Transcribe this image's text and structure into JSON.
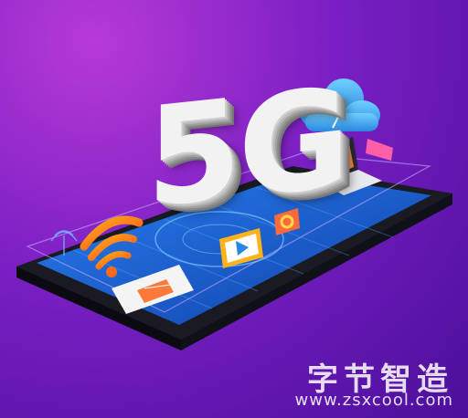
{
  "hero": {
    "text": "5G"
  },
  "watermark": {
    "title": "字节智造",
    "url": "www.zsxcool.com"
  },
  "icons": [
    "wifi-icon",
    "cloud-icon",
    "laptop-icon",
    "play-video-icon",
    "gear-icon",
    "sim-card-icon",
    "satellite-icon"
  ],
  "colors": {
    "background": "#7a1fc4",
    "screen": "#1e5fd6",
    "wifi": "#ff7a1a",
    "cloud": "#3fa8f0"
  }
}
